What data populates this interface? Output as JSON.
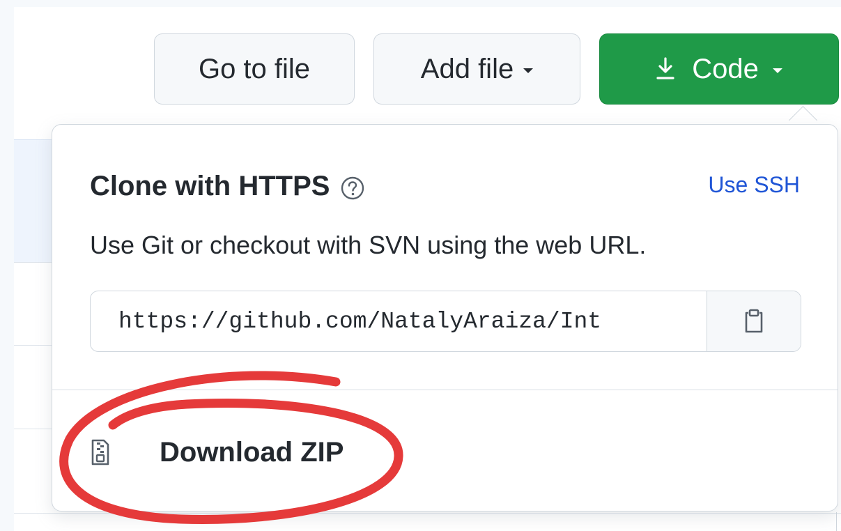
{
  "toolbar": {
    "go_to_file_label": "Go to file",
    "add_file_label": "Add file",
    "code_label": "Code"
  },
  "clone_panel": {
    "title": "Clone with HTTPS",
    "use_ssh_label": "Use SSH",
    "description": "Use Git or checkout with SVN using the web URL.",
    "url_value": "https://github.com/NatalyAraiza/Int"
  },
  "download": {
    "label": "Download ZIP"
  },
  "icons": {
    "code_button": "download-icon",
    "help": "question-icon",
    "copy": "clipboard-icon",
    "zip": "file-zip-icon",
    "dropdown": "caret-down-icon"
  },
  "colors": {
    "code_button_bg": "#1f9a48",
    "link": "#1f55d6",
    "highlight_ring": "#e53a3a"
  }
}
